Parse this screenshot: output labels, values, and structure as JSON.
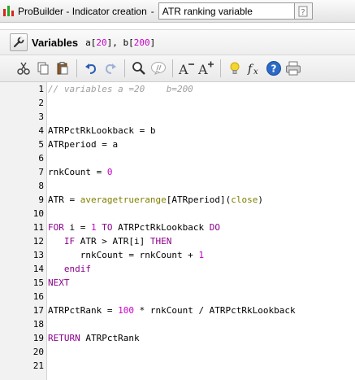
{
  "window": {
    "app_title": "ProBuilder - Indicator creation",
    "separator": "-",
    "indicator_name": "ATR ranking variable"
  },
  "variables_bar": {
    "label": "Variables",
    "values_text_a": "a[",
    "value_a": "20",
    "values_text_b": "], b[",
    "value_b": "200",
    "values_text_end": "]"
  },
  "toolbar": {
    "buttons": [
      "cut-icon",
      "copy-icon",
      "paste-icon",
      "undo-icon",
      "redo-icon",
      "find-icon",
      "comment-icon",
      "decrease-font-icon",
      "increase-font-icon",
      "tip-icon",
      "function-icon",
      "help-icon",
      "print-icon"
    ],
    "font_glyph": "A",
    "function_glyph": "fx",
    "help_glyph": "?"
  },
  "editor": {
    "line_numbers": [
      "1",
      "2",
      "3",
      "4",
      "5",
      "6",
      "7",
      "8",
      "9",
      "10",
      "11",
      "12",
      "13",
      "14",
      "15",
      "16",
      "17",
      "18",
      "19",
      "20",
      "21"
    ],
    "lines": {
      "l1": "// variables a =20    b=200",
      "l4": "ATRPctRkLookback = b",
      "l5": "ATRperiod = a",
      "l7_a": "rnkCount = ",
      "l7_b": "0",
      "l9_a": "ATR = ",
      "l9_b": "averagetruerange",
      "l9_c": "[ATRperiod](",
      "l9_d": "close",
      "l9_e": ")",
      "l11_a": "FOR",
      "l11_b": " i = ",
      "l11_c": "1",
      "l11_d": " TO",
      "l11_e": " ATRPctRkLookback ",
      "l11_f": "DO",
      "l12_a": "   IF",
      "l12_b": " ATR > ATR[i] ",
      "l12_c": "THEN",
      "l13_a": "      rnkCount = rnkCount + ",
      "l13_b": "1",
      "l14": "   endif",
      "l15": "NEXT",
      "l17_a": "ATRPctRank = ",
      "l17_b": "100",
      "l17_c": " * rnkCount / ATRPctRkLookback",
      "l19_a": "RETURN",
      "l19_b": " ATRPctRank"
    }
  },
  "colors": {
    "comment": "#a0a0a0",
    "number": "#c800c8",
    "keyword": "#8b008b",
    "function": "#808000",
    "help_blue": "#2a6bc7"
  }
}
